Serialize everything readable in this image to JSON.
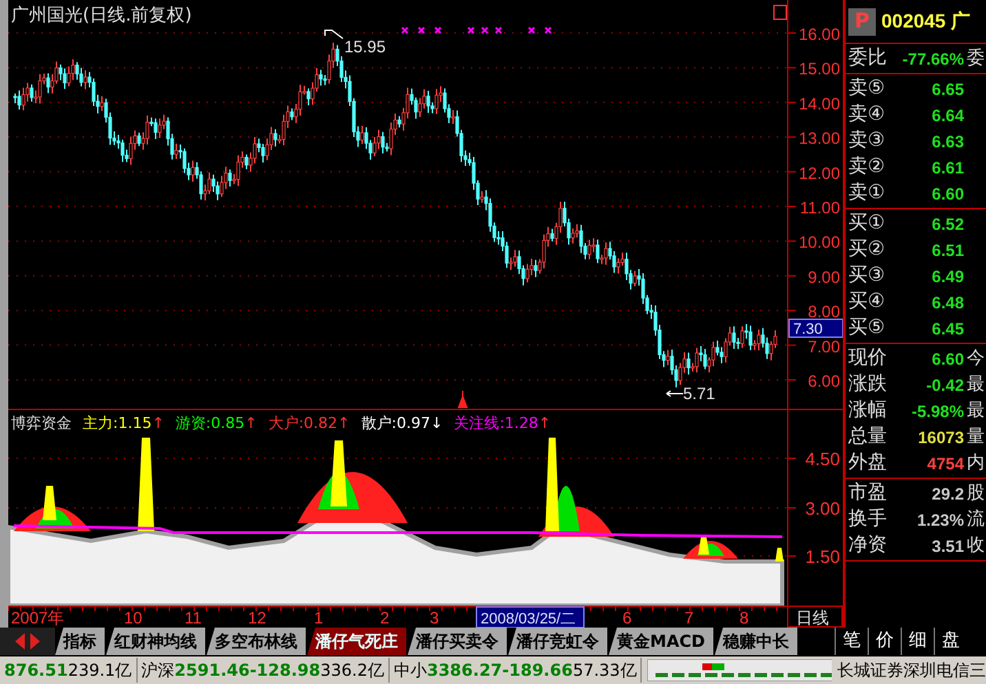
{
  "chart": {
    "title": "广州国光(日线.前复权)",
    "high_label": "15.95",
    "low_label": "5.71",
    "price_axis": [
      "16.00",
      "15.00",
      "14.00",
      "13.00",
      "12.00",
      "11.00",
      "10.00",
      "9.00",
      "8.00",
      "7.00",
      "6.00"
    ],
    "current_price_tag": "7.30"
  },
  "indicator": {
    "name": "博弈资金",
    "legend": [
      {
        "label": "主力:1.15",
        "arrow": "↑",
        "kind": "up",
        "color": "#ffff00"
      },
      {
        "label": "游资:0.85",
        "arrow": "↑",
        "kind": "up",
        "color": "#00ff00"
      },
      {
        "label": "大户:0.82",
        "arrow": "↑",
        "kind": "up",
        "color": "#ff3030"
      },
      {
        "label": "散户:0.97",
        "arrow": "↓",
        "kind": "down",
        "color": "#ffffff"
      },
      {
        "label": "关注线:1.28",
        "arrow": "↑",
        "kind": "up",
        "color": "#ff00ff"
      }
    ],
    "axis": [
      "4.50",
      "3.00",
      "1.50"
    ]
  },
  "date_axis": [
    {
      "label": "2007年",
      "kind": "month"
    },
    {
      "label": "10",
      "kind": "month"
    },
    {
      "label": "11",
      "kind": "month"
    },
    {
      "label": "12",
      "kind": "month"
    },
    {
      "label": "1",
      "kind": "month"
    },
    {
      "label": "2",
      "kind": "month"
    },
    {
      "label": "3",
      "kind": "month"
    },
    {
      "label": "2008/03/25/二",
      "kind": "cursor"
    },
    {
      "label": "6",
      "kind": "month"
    },
    {
      "label": "7",
      "kind": "month"
    },
    {
      "label": "8",
      "kind": "month"
    }
  ],
  "period_label": "日线",
  "tabs": [
    {
      "label": "指标",
      "selected": false
    },
    {
      "label": "红财神均线",
      "selected": false
    },
    {
      "label": "多空布林线",
      "selected": false
    },
    {
      "label": "潘仔气死庄",
      "selected": true
    },
    {
      "label": "潘仔买卖令",
      "selected": false
    },
    {
      "label": "潘仔竞虹令",
      "selected": false
    },
    {
      "label": "黄金MACD",
      "selected": false
    },
    {
      "label": "稳赚中长",
      "selected": false
    }
  ],
  "side_tabs": [
    "笔",
    "价",
    "细",
    "盘"
  ],
  "quote_panel": {
    "badge": "P",
    "code": "002045",
    "name": "广",
    "ratio": {
      "label": "委比",
      "value": "-77.66%",
      "extra": "委",
      "color": "#20e020"
    },
    "asks": [
      {
        "label": "卖⑤",
        "value": "6.65",
        "color": "#20e020"
      },
      {
        "label": "卖④",
        "value": "6.64",
        "color": "#20e020"
      },
      {
        "label": "卖③",
        "value": "6.63",
        "color": "#20e020"
      },
      {
        "label": "卖②",
        "value": "6.61",
        "color": "#20e020"
      },
      {
        "label": "卖①",
        "value": "6.60",
        "color": "#20e020"
      }
    ],
    "bids": [
      {
        "label": "买①",
        "value": "6.52",
        "color": "#20e020"
      },
      {
        "label": "买②",
        "value": "6.51",
        "color": "#20e020"
      },
      {
        "label": "买③",
        "value": "6.49",
        "color": "#20e020"
      },
      {
        "label": "买④",
        "value": "6.48",
        "color": "#20e020"
      },
      {
        "label": "买⑤",
        "value": "6.45",
        "color": "#20e020"
      }
    ],
    "quotes": [
      {
        "label": "现价",
        "value": "6.60",
        "extra": "今",
        "color": "#20e020"
      },
      {
        "label": "涨跌",
        "value": "-0.42",
        "extra": "最",
        "color": "#20e020"
      },
      {
        "label": "涨幅",
        "value": "-5.98%",
        "extra": "最",
        "color": "#20e020"
      },
      {
        "label": "总量",
        "value": "16073",
        "extra": "量",
        "color": "#e0e040"
      },
      {
        "label": "外盘",
        "value": "4754",
        "extra": "内",
        "color": "#ff4040"
      }
    ],
    "fundamentals": [
      {
        "label": "市盈",
        "value": "29.2",
        "extra": "股",
        "color": "#c8c8c8"
      },
      {
        "label": "换手",
        "value": "1.23%",
        "extra": "流",
        "color": "#c8c8c8"
      },
      {
        "label": "净资",
        "value": "3.51",
        "extra": "收",
        "color": "#c8c8c8"
      }
    ]
  },
  "status_bar": [
    {
      "parts": [
        {
          "text": "876.51",
          "color": "#008000"
        },
        {
          "text": "239.1亿",
          "color": "#000000"
        }
      ]
    },
    {
      "parts": [
        {
          "text": "沪深",
          "color": "#000000"
        },
        {
          "text": "2591.46",
          "color": "#008000"
        },
        {
          "text": "-128.98",
          "color": "#008000"
        },
        {
          "text": "336.2亿",
          "color": "#000000"
        }
      ]
    },
    {
      "parts": [
        {
          "text": "中小",
          "color": "#000000"
        },
        {
          "text": "3386.27",
          "color": "#008000"
        },
        {
          "text": "-189.66",
          "color": "#008000"
        },
        {
          "text": "57.33亿",
          "color": "#000000"
        }
      ]
    }
  ],
  "broker": "长城证券深圳电信三"
}
